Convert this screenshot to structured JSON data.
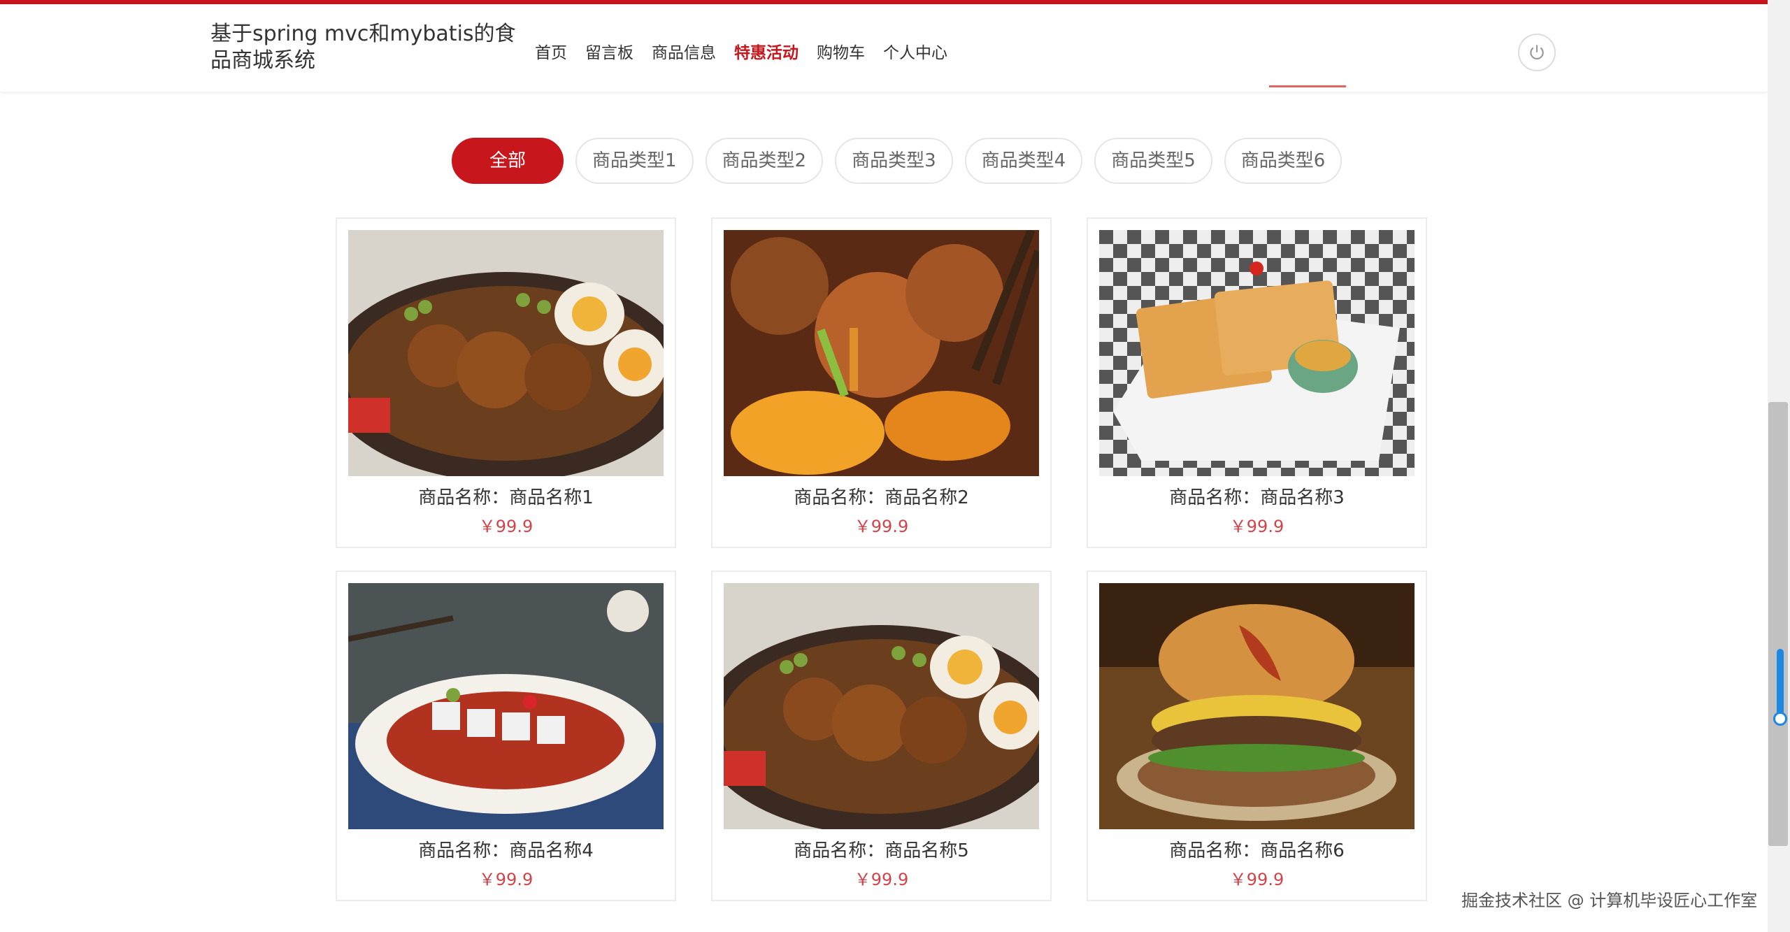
{
  "header": {
    "site_title": "基于spring mvc和mybatis的食品商城系统",
    "nav": [
      "首页",
      "留言板",
      "商品信息",
      "特惠活动",
      "购物车",
      "个人中心"
    ],
    "active_nav": "特惠活动",
    "power_icon": "power-icon"
  },
  "filters": {
    "items": [
      "全部",
      "商品类型1",
      "商品类型2",
      "商品类型3",
      "商品类型4",
      "商品类型5",
      "商品类型6"
    ],
    "active": "全部"
  },
  "products": [
    {
      "name": "商品名称：商品名称1",
      "price": "￥99.9",
      "image": "rice-bowl-chicken-egg"
    },
    {
      "name": "商品名称：商品名称2",
      "price": "￥99.9",
      "image": "braised-chicken-chopsticks"
    },
    {
      "name": "商品名称：商品名称3",
      "price": "￥99.9",
      "image": "waffle-plate"
    },
    {
      "name": "商品名称：商品名称4",
      "price": "￥99.9",
      "image": "cold-noodle-chili-dish"
    },
    {
      "name": "商品名称：商品名称5",
      "price": "￥99.9",
      "image": "rice-bowl-chicken-egg"
    },
    {
      "name": "商品名称：商品名称6",
      "price": "￥99.9",
      "image": "bacon-cheeseburger"
    }
  ],
  "watermark": "掘金技术社区 @ 计算机毕设匠心工作室",
  "colors": {
    "accent": "#c8161d",
    "price": "#c8161d",
    "border": "#ececec"
  }
}
